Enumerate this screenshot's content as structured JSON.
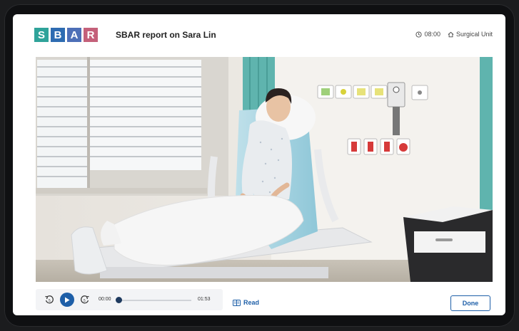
{
  "logo": {
    "letters": [
      "S",
      "B",
      "A",
      "R"
    ],
    "colors": [
      "#2fa39a",
      "#2e6cb2",
      "#4d6fb7",
      "#c4607a"
    ]
  },
  "header": {
    "title": "SBAR report on Sara Lin",
    "time": "08:00",
    "time_icon": "clock-icon",
    "unit": "Surgical Unit",
    "unit_icon": "home-icon"
  },
  "player": {
    "rewind_icon": "rewind-5-icon",
    "play_icon": "play-icon",
    "forward_icon": "forward-5-icon",
    "current_time": "00:00",
    "total_time": "01:53",
    "progress": 0
  },
  "actions": {
    "read_label": "Read",
    "read_icon": "book-icon",
    "done_label": "Done"
  },
  "accent": "#1e5fa8"
}
